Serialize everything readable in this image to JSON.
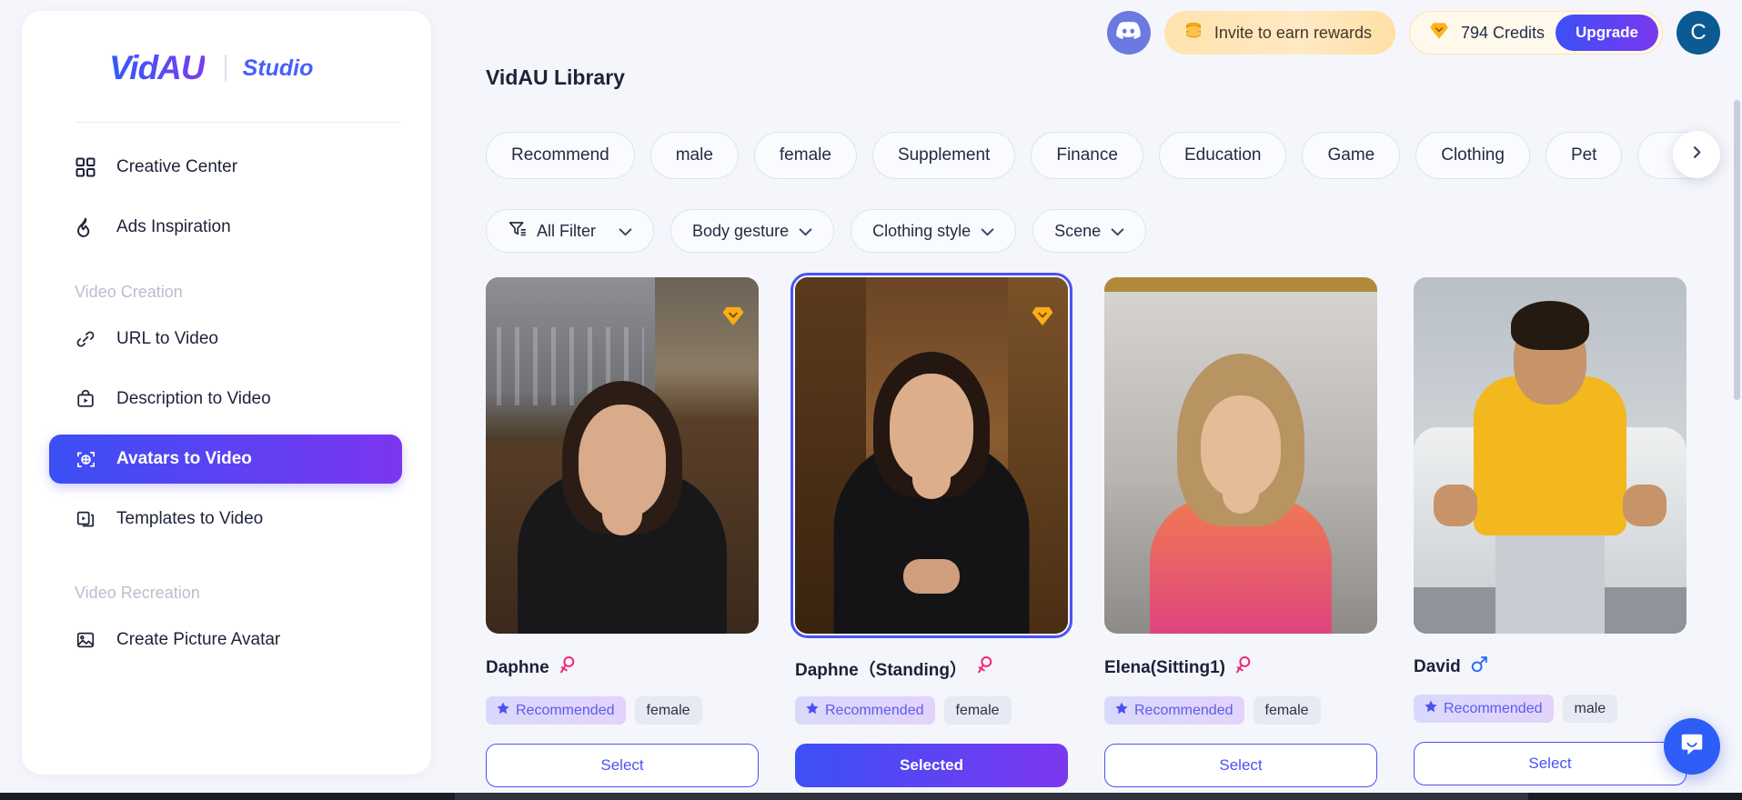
{
  "brand": {
    "logo": "VidAU",
    "studio": "Studio"
  },
  "sidebar": {
    "items": [
      {
        "label": "Creative Center",
        "icon": "grid-icon"
      },
      {
        "label": "Ads Inspiration",
        "icon": "flame-icon"
      }
    ],
    "groups": [
      {
        "title": "Video Creation",
        "items": [
          {
            "label": "URL to Video",
            "icon": "link-icon",
            "active": false
          },
          {
            "label": "Description to Video",
            "icon": "bag-play-icon",
            "active": false
          },
          {
            "label": "Avatars to Video",
            "icon": "avatar-target-icon",
            "active": true
          },
          {
            "label": "Templates to Video",
            "icon": "templates-icon",
            "active": false
          }
        ]
      },
      {
        "title": "Video Recreation",
        "items": [
          {
            "label": "Create Picture Avatar",
            "icon": "image-icon",
            "active": false
          }
        ]
      }
    ]
  },
  "header": {
    "discord_label": "discord-icon",
    "invite_label": "Invite to earn rewards",
    "credits_label": "794 Credits",
    "upgrade_label": "Upgrade",
    "avatar_initial": "C"
  },
  "main": {
    "library_title": "VidAU Library",
    "category_chips": [
      "Recommend",
      "male",
      "female",
      "Supplement",
      "Finance",
      "Education",
      "Game",
      "Clothing",
      "Pet"
    ],
    "next_chip_icon": "chevron-right-icon",
    "filters": [
      {
        "label": "All Filter",
        "leading_icon": "filter-icon",
        "caret": true
      },
      {
        "label": "Body gesture",
        "leading_icon": "",
        "caret": true
      },
      {
        "label": "Clothing style",
        "leading_icon": "",
        "caret": true
      },
      {
        "label": "Scene",
        "leading_icon": "",
        "caret": true
      }
    ],
    "cards": [
      {
        "name": "Daphne",
        "gender_icon": "female-icon",
        "gender": "female",
        "recommended_label": "Recommended",
        "premium_badge": true,
        "selected": false,
        "button_label": "Select",
        "button_style": "outline",
        "scene": "bar"
      },
      {
        "name": "Daphne（Standing）",
        "gender_icon": "female-icon",
        "gender": "female",
        "recommended_label": "Recommended",
        "premium_badge": true,
        "selected": true,
        "button_label": "Selected",
        "button_style": "filled",
        "scene": "wood"
      },
      {
        "name": "Elena(Sitting1)",
        "gender_icon": "female-icon",
        "gender": "female",
        "recommended_label": "Recommended",
        "premium_badge": false,
        "selected": false,
        "button_label": "Select",
        "button_style": "outline",
        "scene": "marble"
      },
      {
        "name": "David",
        "gender_icon": "male-icon",
        "gender": "male",
        "recommended_label": "Recommended",
        "premium_badge": false,
        "selected": false,
        "button_label": "Select",
        "button_style": "outline",
        "scene": "car"
      }
    ]
  },
  "colors": {
    "accent_start": "#3c50f6",
    "accent_end": "#7c37ef",
    "gold": "#f9a825",
    "female_pink": "#f0267a",
    "male_blue": "#2f6df5",
    "page_bg": "#f5f6fb"
  },
  "widgets": {
    "chat_icon": "chat-bubble-icon"
  }
}
